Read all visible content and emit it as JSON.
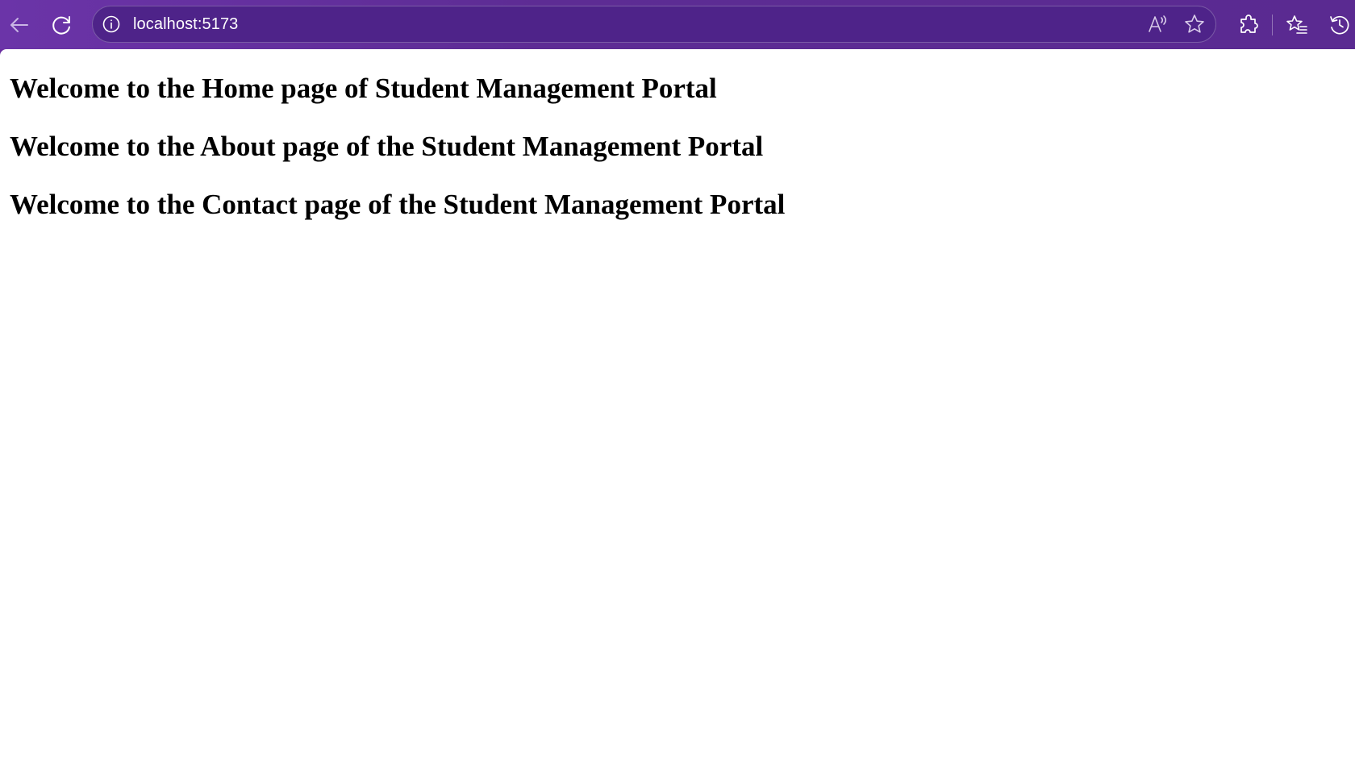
{
  "browser": {
    "address_bar": {
      "url": "localhost:5173"
    },
    "icons": {
      "back": "back-arrow-icon",
      "refresh": "refresh-icon",
      "site_info": "info-icon",
      "read_aloud": "read-aloud-icon",
      "favorite": "star-icon",
      "extensions": "puzzle-icon",
      "favorites": "favorites-list-icon",
      "history": "history-icon"
    },
    "colors": {
      "toolbar": "#5d2c94",
      "address_bar": "#4e2389",
      "page_background": "#ffffff"
    }
  },
  "page": {
    "headings": [
      "Welcome to the Home page of Student Management Portal",
      "Welcome to the About page of the Student Management Portal",
      "Welcome to the Contact page of the Student Management Portal"
    ]
  }
}
